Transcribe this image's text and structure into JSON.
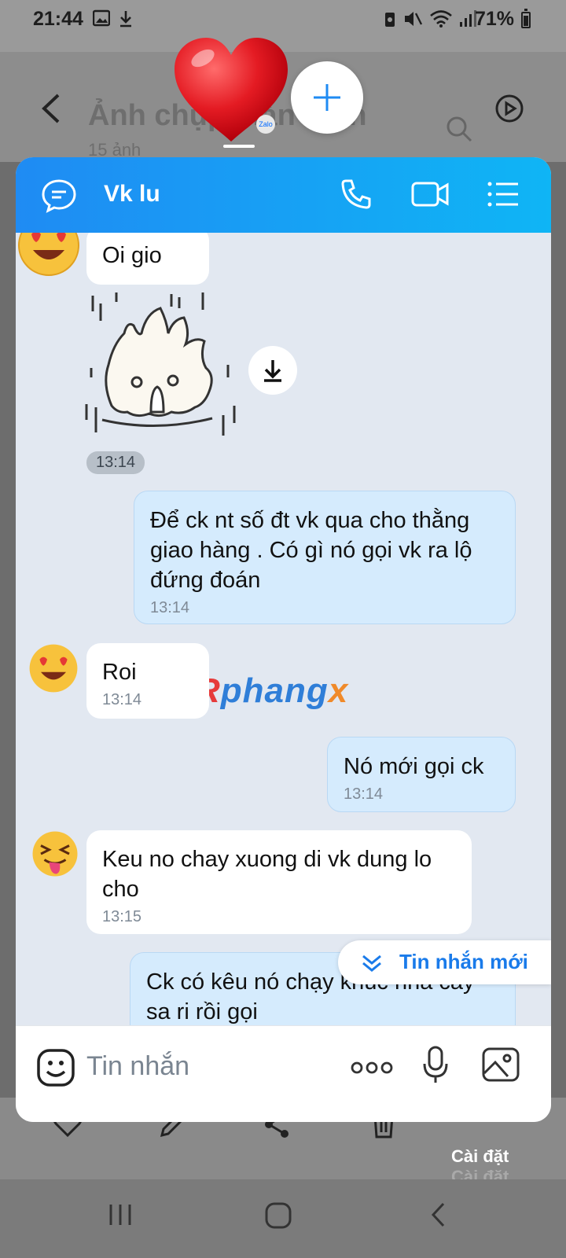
{
  "status_bar": {
    "time": "21:44",
    "battery": "71%"
  },
  "background_app": {
    "title": "Ảnh chụp màn hình",
    "subtitle": "15 ảnh",
    "toolbar_more_label": "Cài đặt"
  },
  "zalo_badge": "Zalo",
  "chat": {
    "contact_name": "Vk lu",
    "sticker_time": "13:14",
    "messages": [
      {
        "side": "in",
        "text": "Oi gio",
        "time": ""
      },
      {
        "side": "out",
        "text": "Để ck nt số đt vk qua cho thằng giao hàng . Có gì nó gọi vk ra lộ đứng đoán",
        "time": "13:14"
      },
      {
        "side": "in",
        "text": "Roi",
        "time": "13:14"
      },
      {
        "side": "out",
        "text": "Nó mới gọi ck",
        "time": "13:14"
      },
      {
        "side": "in",
        "text": "Keu no chay xuong di vk dung lo cho",
        "time": "13:15"
      },
      {
        "side": "out",
        "text": "Ck có kêu nó chạy khúc nhà cây sa ri rồi gọi",
        "time": ""
      }
    ],
    "new_message_label": "Tin nhắn mới",
    "input_placeholder": "Tin nhắn"
  },
  "watermark": {
    "part1": "R",
    "part2": "phang",
    "part3": "x"
  },
  "colors": {
    "header_start": "#1f8bf3",
    "header_end": "#0fb5f5",
    "outgoing_bubble": "#d5ebfd",
    "incoming_bubble": "#ffffff",
    "chat_background": "#e2e8f1",
    "accent": "#1a7bea"
  }
}
